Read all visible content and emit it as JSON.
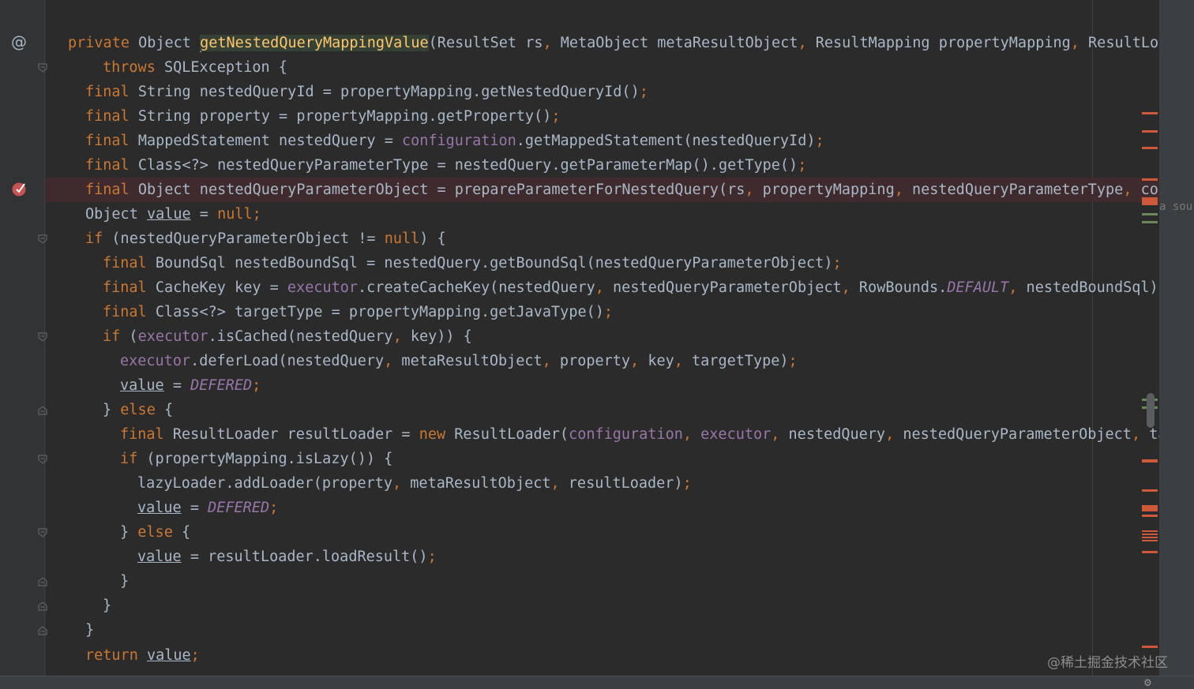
{
  "editor": {
    "overflow_hint": "a sou",
    "watermark": "@稀土掘金技术社区",
    "lines": {
      "l0_private": "private",
      "l0_object": " Object ",
      "l0_name": "getNestedQueryMappingValue",
      "l0_rest1": "(ResultSet rs",
      "l0_rest2": " MetaObject metaResultObject",
      "l0_rest3": " ResultMapping propertyMapping",
      "l0_rest4": " ResultLoad",
      "l1_throws": "throws",
      "l1_rest": " SQLException {",
      "l2_rest": " String nestedQueryId = propertyMapping.getNestedQueryId()",
      "l3_rest": " String property = propertyMapping.getProperty()",
      "l4_a": " MappedStatement nestedQuery = ",
      "l4_field": "configuration",
      "l4_b": ".getMappedStatement(nestedQueryId)",
      "l5_rest": " Class<?> nestedQueryParameterType = nestedQuery.getParameterMap().getType()",
      "l6_a": " Object nestedQueryParameterObject = prepareParameterForNestedQuery(rs",
      "l6_b": " propertyMapping",
      "l6_c": " nestedQueryParameterType",
      "l6_d": " colu",
      "l7_object": "Object ",
      "l7_value": "value",
      "l7_eq": " = ",
      "l7_null": "null",
      "l8_if": "if",
      "l8_mid": " (nestedQueryParameterObject != ",
      "l8_null": "null",
      "l8_end": ") {",
      "l9_rest": " BoundSql nestedBoundSql = nestedQuery.getBoundSql(nestedQueryParameterObject)",
      "l10_a": " CacheKey key = ",
      "l10_executor": "executor",
      "l10_b": ".createCacheKey(nestedQuery",
      "l10_c": " nestedQueryParameterObject",
      "l10_d": " RowBounds.",
      "l10_default": "DEFAULT",
      "l10_e": " nestedBoundSql)",
      "l11_rest": " Class<?> targetType = propertyMapping.getJavaType()",
      "l12_if": "if",
      "l12_a": " (",
      "l12_executor": "executor",
      "l12_b": ".isCached(nestedQuery",
      "l12_c": " key)) {",
      "l13_executor": "executor",
      "l13_a": ".deferLoad(nestedQuery",
      "l13_b": " metaResultObject",
      "l13_c": " property",
      "l13_d": " key",
      "l13_e": " targetType)",
      "l14_value": "value",
      "l14_eq": " = ",
      "l14_defered": "DEFERED",
      "l15_brace": "} ",
      "l15_else": "else",
      "l15_open": " {",
      "l16_a": " ResultLoader resultLoader = ",
      "l16_new": "new",
      "l16_b": " ResultLoader(",
      "l16_config": "configuration",
      "l16_executor": "executor",
      "l16_c": " nestedQuery",
      "l16_d": " nestedQueryParameterObject",
      "l16_e": " tar",
      "l17_if": "if",
      "l17_rest": " (propertyMapping.isLazy()) {",
      "l18_rest": "lazyLoader.addLoader(property",
      "l18_b": " metaResultObject",
      "l18_c": " resultLoader)",
      "l19_value": "value",
      "l19_eq": " = ",
      "l19_defered": "DEFERED",
      "l20_brace": "} ",
      "l20_else": "else",
      "l20_open": " {",
      "l21_value": "value",
      "l21_rest": " = resultLoader.loadResult()",
      "l22": "}",
      "l23": "}",
      "l24": "}",
      "l25_return": "return",
      "l25_value": "value",
      "kw_final": "final",
      "semi": ";",
      "comma": ","
    }
  },
  "icons": {
    "gutter_at": "@",
    "breakpoint": "breakpoint-icon",
    "fold": "fold-marker-icon",
    "status": "⚙"
  },
  "colors": {
    "background": "#2b2b2b",
    "keyword": "#cc7832",
    "field": "#9876aa",
    "method_decl": "#ffc66d",
    "text": "#a9b7c6",
    "breakpoint_row": "#3f2b2d",
    "breakpoint": "#c75450"
  }
}
